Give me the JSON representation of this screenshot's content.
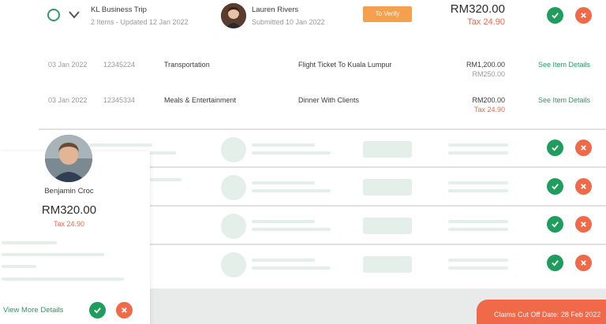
{
  "claim": {
    "title": "KL Business Trip",
    "subtitle": "2 Items - Updated 12 Jan 2022",
    "submitter_name": "Lauren Rivers",
    "submitted": "Submitted 10 Jan 2022",
    "status_label": "To Verify",
    "amount": "RM320.00",
    "tax": "Tax 24.90"
  },
  "items": [
    {
      "date": "03 Jan 2022",
      "id": "12345224",
      "category": "Transportation",
      "description": "Flight Ticket To Kuala Lumpur",
      "amount": "RM1,200.00",
      "sub": "RM250.00",
      "link": "See Item Details"
    },
    {
      "date": "03 Jan 2022",
      "id": "12345334",
      "category": "Meals & Entertainment",
      "description": "Dinner With Clients",
      "amount": "RM200.00",
      "sub": "Tax 24.90",
      "link": "See Item Details"
    }
  ],
  "card": {
    "name": "Benjamin Croc",
    "amount": "RM320.00",
    "tax": "Tax 24.90",
    "link": "View More Details"
  },
  "footer": {
    "cutoff": "Claims Cut Off Date: 28 Feb 2022"
  },
  "colors": {
    "approve": "#1f9d5c",
    "reject": "#f06a4a",
    "verify": "#f5a04f",
    "link": "#2e9a68",
    "skeleton": "#e4efea"
  }
}
